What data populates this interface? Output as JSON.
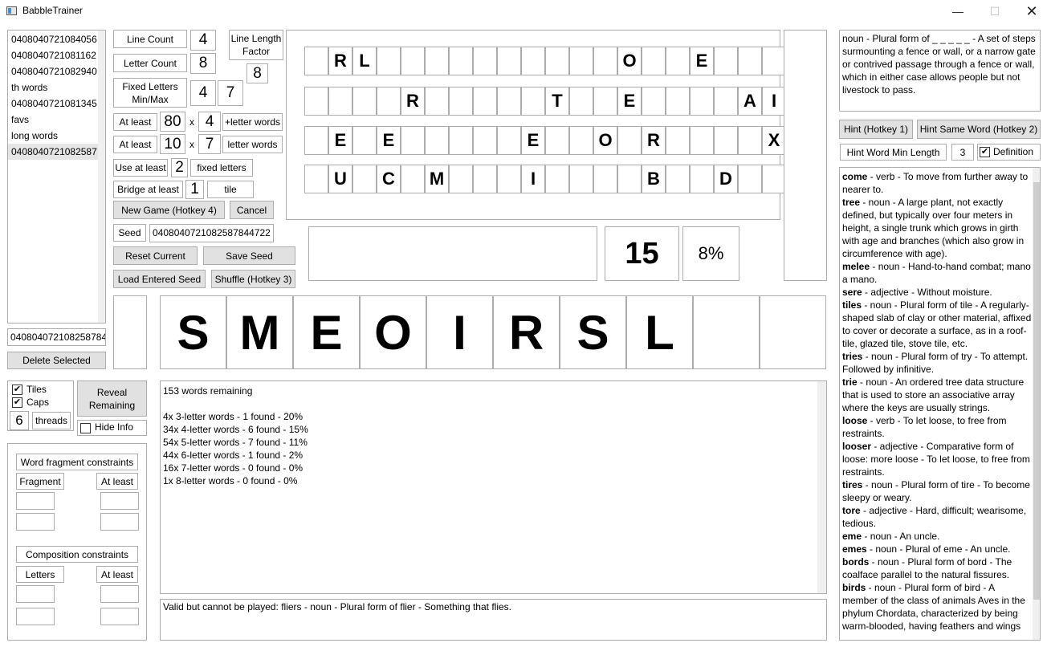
{
  "window": {
    "title": "BabbleTrainer"
  },
  "seed_list": {
    "items": [
      "0408040721084056",
      "0408040721081162",
      "0408040721082940",
      "th words",
      "0408040721081345",
      "favs",
      "long words",
      "0408040721082587"
    ],
    "selected_index": 7
  },
  "seed_entry": {
    "value": "0408040721082587844"
  },
  "buttons": {
    "delete_selected": "Delete Selected",
    "reveal_remaining": "Reveal Remaining",
    "new_game": "New Game (Hotkey 4)",
    "cancel": "Cancel",
    "reset_current": "Reset Current",
    "save_seed": "Save Seed",
    "load_entered_seed": "Load Entered Seed",
    "shuffle": "Shuffle (Hotkey 3)",
    "hint": "Hint (Hotkey 1)",
    "hint_same_word": "Hint Same Word (Hotkey 2)"
  },
  "options": {
    "tiles_label": "Tiles",
    "tiles_checked": true,
    "caps_label": "Caps",
    "caps_checked": true,
    "threads_value": "6",
    "threads_label": "threads",
    "hide_info_label": "Hide Info",
    "hide_info_checked": false
  },
  "settings": {
    "line_count_label": "Line Count",
    "line_count_value": "4",
    "letter_count_label": "Letter Count",
    "letter_count_value": "8",
    "line_length_factor_label": "Line Length Factor",
    "line_length_factor_value": "8",
    "fixed_letters_label": "Fixed Letters Min/Max",
    "fixed_letters_min": "4",
    "fixed_letters_max": "7",
    "at_least_1_label": "At least",
    "at_least_1_value": "80",
    "x1": "x",
    "at_least_1_mult": "4",
    "at_least_1_suffix": "+letter words",
    "at_least_2_label": "At least",
    "at_least_2_value": "10",
    "x2": "x",
    "at_least_2_mult": "7",
    "at_least_2_suffix": "letter words",
    "use_at_least_label": "Use at least",
    "use_at_least_value": "2",
    "use_at_least_suffix": "fixed letters",
    "bridge_at_least_label": "Bridge at least",
    "bridge_at_least_value": "1",
    "bridge_at_least_suffix": "tile",
    "seed_label": "Seed",
    "seed_value": "0408040721082587844722"
  },
  "constraints": {
    "fragment_header": "Word fragment constraints",
    "fragment_col": "Fragment",
    "fragment_at_least_col": "At least",
    "composition_header": "Composition constraints",
    "letters_col": "Letters",
    "letters_at_least_col": "At least"
  },
  "board": {
    "rows": [
      [
        "",
        "R",
        "L",
        "",
        "",
        "",
        "",
        "",
        "",
        "",
        "",
        "",
        "",
        "O",
        "",
        "",
        "E",
        "",
        "",
        ""
      ],
      [
        "",
        "",
        "",
        "",
        "R",
        "",
        "",
        "",
        "",
        "",
        "T",
        "",
        "",
        "E",
        "",
        "",
        "",
        "",
        "A",
        "I"
      ],
      [
        "",
        "E",
        "",
        "E",
        "",
        "",
        "",
        "",
        "",
        "E",
        "",
        "",
        "O",
        "",
        "R",
        "",
        "",
        "",
        "",
        "X"
      ],
      [
        "",
        "U",
        "",
        "C",
        "",
        "M",
        "",
        "",
        "",
        "I",
        "",
        "",
        "",
        "",
        "B",
        "",
        "",
        "D",
        "",
        ""
      ]
    ]
  },
  "score": {
    "value": "15",
    "percent": "8%"
  },
  "rack": {
    "tiles": [
      "S",
      "M",
      "E",
      "O",
      "I",
      "R",
      "S",
      "L",
      "",
      ""
    ]
  },
  "stats": {
    "lines": [
      "153 words remaining",
      "",
      "4x 3-letter words - 1 found - 20%",
      "34x 4-letter words - 6 found - 15%",
      "54x 5-letter words - 7 found - 11%",
      "44x 6-letter words - 1 found - 2%",
      "16x 7-letter words - 0 found - 0%",
      "1x 8-letter words - 0 found - 0%"
    ]
  },
  "message": "Valid but cannot be played: fliers - noun - Plural form of flier - Something that flies.",
  "hint_panel": {
    "text": "noun - Plural form of _ _ _ _ _ - A set of steps surmounting a fence or wall, or a narrow gate or contrived passage through a fence or wall, which in either case allows people but not livestock to pass.",
    "min_length_label": "Hint Word Min Length",
    "min_length_value": "3",
    "definition_label": "Definition",
    "definition_checked": true
  },
  "definitions": [
    {
      "word": "come",
      "text": " - verb - To move from further away to nearer to."
    },
    {
      "word": "tree",
      "text": " - noun - A large plant, not exactly defined, but typically over four meters in height, a single trunk which grows in girth with age and branches (which also grow in circumference with age)."
    },
    {
      "word": "melee",
      "text": " - noun - Hand-to-hand combat; mano a mano."
    },
    {
      "word": "sere",
      "text": " - adjective - Without moisture."
    },
    {
      "word": "tiles",
      "text": " - noun - Plural form of tile - A regularly-shaped slab of clay or other material, affixed to cover or decorate a surface, as in a roof-tile, glazed tile, stove tile, etc."
    },
    {
      "word": "tries",
      "text": " - noun - Plural form of try - To attempt. Followed by infinitive."
    },
    {
      "word": "trie",
      "text": " - noun - An ordered tree data structure that is used to store an associative array where the keys are usually strings."
    },
    {
      "word": "loose",
      "text": " - verb - To let loose, to free from restraints."
    },
    {
      "word": "looser",
      "text": " - adjective - Comparative form of loose: more loose - To let loose, to free from restraints."
    },
    {
      "word": "tires",
      "text": " - noun - Plural form of tire - To become sleepy or weary."
    },
    {
      "word": "tore",
      "text": " - adjective - Hard, difficult; wearisome, tedious."
    },
    {
      "word": "eme",
      "text": " - noun - An uncle."
    },
    {
      "word": "emes",
      "text": " - noun - Plural of eme - An uncle."
    },
    {
      "word": "bords",
      "text": " - noun - Plural form of bord - The coalface parallel to the natural fissures."
    },
    {
      "word": "birds",
      "text": " - noun - Plural form of bird - A member of the class of animals Aves in the phylum Chordata, characterized by being warm-blooded, having feathers and wings"
    }
  ]
}
